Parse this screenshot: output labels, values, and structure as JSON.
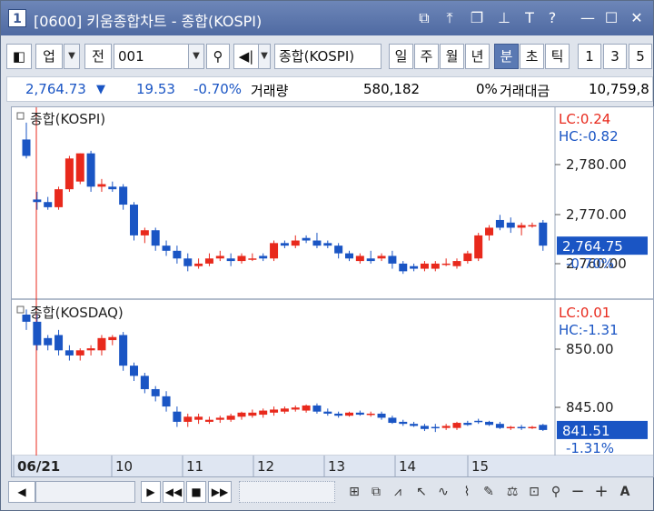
{
  "window": {
    "badge": "1",
    "title": "[0600] 키움종합차트 - 종합(KOSPI)"
  },
  "toolbar": {
    "market_label": "업",
    "all_label": "전",
    "code_value": "001",
    "name_value": "종합(KOSPI)",
    "periods": [
      "일",
      "주",
      "월",
      "년",
      "분",
      "초",
      "틱"
    ],
    "selected_period": "분",
    "intervals": [
      "1",
      "3",
      "5"
    ]
  },
  "info": {
    "price": "2,764.73",
    "change": "19.53",
    "change_pct": "-0.70%",
    "volume_label": "거래량",
    "volume": "580,182",
    "volume_pct": "0%",
    "amount_label": "거래대금",
    "amount": "10,759,8"
  },
  "colors": {
    "up": "#e8291c",
    "down": "#1a55c4",
    "price_label_bg": "#1a55c4",
    "grid": "#b9c3d2"
  },
  "x_axis": {
    "labels": [
      "06/21",
      "10",
      "11",
      "12",
      "13",
      "14",
      "15"
    ]
  },
  "chart_data": [
    {
      "type": "candlestick",
      "title": "종합(KOSPI)",
      "lc": "LC:0.24",
      "hc": "HC:-0.82",
      "y_ticks": [
        "2,780.00",
        "2,770.00",
        "2,760.00"
      ],
      "ylim": [
        2758.5,
        2789.0
      ],
      "last_price": "2,764.75",
      "last_pct": "-0.70%",
      "candles": [
        [
          2785.2,
          2788.5,
          2781.5,
          2782.0
        ],
        [
          2773.5,
          2775.0,
          2771.5,
          2773.0
        ],
        [
          2773.0,
          2774.0,
          2771.5,
          2772.0
        ],
        [
          2772.0,
          2776.0,
          2771.5,
          2775.5
        ],
        [
          2775.5,
          2782.0,
          2775.0,
          2781.5
        ],
        [
          2777.0,
          2782.5,
          2776.5,
          2782.5
        ],
        [
          2782.5,
          2783.0,
          2775.0,
          2776.0
        ],
        [
          2776.0,
          2777.5,
          2775.0,
          2776.5
        ],
        [
          2776.0,
          2777.0,
          2775.0,
          2775.5
        ],
        [
          2776.0,
          2776.5,
          2771.5,
          2772.5
        ],
        [
          2772.5,
          2773.0,
          2765.5,
          2766.5
        ],
        [
          2766.5,
          2768.0,
          2765.0,
          2767.5
        ],
        [
          2767.5,
          2768.0,
          2763.5,
          2764.5
        ],
        [
          2764.5,
          2765.5,
          2762.5,
          2763.5
        ],
        [
          2763.5,
          2764.5,
          2761.0,
          2762.0
        ],
        [
          2762.0,
          2763.0,
          2759.5,
          2760.5
        ],
        [
          2760.5,
          2762.0,
          2760.0,
          2761.0
        ],
        [
          2761.0,
          2763.0,
          2760.5,
          2762.0
        ],
        [
          2762.0,
          2763.5,
          2761.5,
          2762.5
        ],
        [
          2762.0,
          2763.0,
          2760.5,
          2761.5
        ],
        [
          2761.5,
          2763.0,
          2761.0,
          2762.5
        ],
        [
          2762.0,
          2763.0,
          2761.5,
          2762.0
        ],
        [
          2762.5,
          2763.0,
          2761.5,
          2762.0
        ],
        [
          2762.0,
          2765.5,
          2761.5,
          2765.0
        ],
        [
          2765.0,
          2765.5,
          2764.0,
          2764.5
        ],
        [
          2764.5,
          2766.5,
          2764.0,
          2765.5
        ],
        [
          2766.0,
          2766.5,
          2765.0,
          2765.5
        ],
        [
          2765.5,
          2767.0,
          2764.0,
          2764.5
        ],
        [
          2765.0,
          2765.5,
          2764.0,
          2764.5
        ],
        [
          2764.5,
          2765.0,
          2762.0,
          2763.0
        ],
        [
          2763.0,
          2763.5,
          2761.5,
          2762.0
        ],
        [
          2761.5,
          2763.0,
          2761.0,
          2762.5
        ],
        [
          2762.0,
          2763.5,
          2761.0,
          2761.5
        ],
        [
          2762.0,
          2763.0,
          2761.5,
          2762.5
        ],
        [
          2762.5,
          2763.5,
          2760.0,
          2761.0
        ],
        [
          2761.0,
          2761.5,
          2759.0,
          2759.5
        ],
        [
          2760.5,
          2761.0,
          2759.5,
          2760.0
        ],
        [
          2760.0,
          2761.5,
          2759.5,
          2761.0
        ],
        [
          2760.0,
          2761.5,
          2759.5,
          2761.0
        ],
        [
          2761.0,
          2762.0,
          2760.5,
          2761.0
        ],
        [
          2760.5,
          2762.0,
          2760.0,
          2761.5
        ],
        [
          2761.5,
          2763.5,
          2761.0,
          2763.0
        ],
        [
          2762.0,
          2767.0,
          2761.5,
          2766.5
        ],
        [
          2766.5,
          2768.5,
          2765.5,
          2768.0
        ],
        [
          2769.5,
          2770.5,
          2767.5,
          2768.0
        ],
        [
          2769.0,
          2770.0,
          2767.0,
          2768.0
        ],
        [
          2768.0,
          2769.0,
          2766.5,
          2768.5
        ],
        [
          2768.5,
          2769.0,
          2768.0,
          2768.5
        ],
        [
          2769.0,
          2769.5,
          2763.5,
          2764.5
        ]
      ]
    },
    {
      "type": "candlestick",
      "title": "종합(KOSDAQ)",
      "lc": "LC:0.01",
      "hc": "HC:-1.31",
      "y_ticks": [
        "850.00",
        "845.00"
      ],
      "ylim": [
        839.5,
        852.5
      ],
      "last_price": "841.51",
      "last_pct": "-1.31%",
      "candles": [
        [
          852.5,
          853.0,
          851.0,
          851.8
        ],
        [
          851.8,
          852.5,
          849.0,
          849.5
        ],
        [
          850.2,
          850.5,
          849.0,
          849.5
        ],
        [
          850.5,
          851.0,
          848.5,
          849.0
        ],
        [
          849.0,
          849.5,
          848.0,
          848.5
        ],
        [
          848.5,
          849.2,
          848.0,
          849.0
        ],
        [
          849.0,
          849.5,
          848.5,
          849.2
        ],
        [
          849.0,
          850.5,
          848.5,
          850.2
        ],
        [
          850.0,
          850.5,
          849.5,
          850.3
        ],
        [
          850.5,
          850.8,
          847.0,
          847.5
        ],
        [
          847.5,
          847.8,
          846.0,
          846.5
        ],
        [
          846.5,
          846.8,
          844.8,
          845.2
        ],
        [
          845.2,
          845.5,
          844.0,
          844.5
        ],
        [
          844.5,
          845.0,
          843.0,
          843.5
        ],
        [
          843.0,
          843.5,
          841.5,
          842.0
        ],
        [
          842.0,
          842.8,
          841.5,
          842.5
        ],
        [
          842.2,
          842.8,
          841.8,
          842.5
        ],
        [
          842.0,
          842.5,
          841.8,
          842.2
        ],
        [
          842.2,
          842.6,
          841.9,
          842.4
        ],
        [
          842.2,
          842.8,
          842.0,
          842.6
        ],
        [
          842.5,
          843.0,
          842.2,
          842.9
        ],
        [
          842.6,
          843.2,
          842.4,
          842.9
        ],
        [
          842.7,
          843.3,
          842.4,
          843.1
        ],
        [
          842.9,
          843.5,
          842.6,
          843.2
        ],
        [
          843.0,
          843.5,
          842.8,
          843.3
        ],
        [
          843.2,
          843.6,
          843.0,
          843.4
        ],
        [
          843.1,
          843.7,
          842.9,
          843.6
        ],
        [
          843.6,
          843.8,
          842.8,
          843.0
        ],
        [
          843.0,
          843.3,
          842.6,
          842.8
        ],
        [
          842.8,
          843.0,
          842.4,
          842.6
        ],
        [
          842.6,
          843.0,
          842.5,
          842.9
        ],
        [
          842.9,
          843.1,
          842.6,
          842.7
        ],
        [
          842.7,
          843.0,
          842.5,
          842.8
        ],
        [
          842.8,
          843.0,
          842.2,
          842.4
        ],
        [
          842.4,
          842.6,
          841.8,
          841.9
        ],
        [
          842.0,
          842.2,
          841.6,
          841.8
        ],
        [
          841.8,
          842.0,
          841.5,
          841.6
        ],
        [
          841.6,
          841.8,
          841.1,
          841.3
        ],
        [
          841.5,
          841.8,
          841.0,
          841.4
        ],
        [
          841.4,
          841.8,
          841.2,
          841.6
        ],
        [
          841.4,
          842.0,
          841.2,
          841.9
        ],
        [
          841.9,
          842.1,
          841.6,
          841.7
        ],
        [
          842.1,
          842.3,
          841.8,
          842.0
        ],
        [
          842.0,
          842.1,
          841.6,
          841.7
        ],
        [
          841.8,
          842.0,
          841.3,
          841.4
        ],
        [
          841.4,
          841.6,
          841.2,
          841.5
        ],
        [
          841.5,
          841.7,
          841.2,
          841.4
        ],
        [
          841.5,
          841.6,
          841.3,
          841.5
        ],
        [
          841.7,
          841.8,
          841.1,
          841.2
        ]
      ]
    }
  ],
  "bottom": {
    "scroll_left": "◀",
    "play_labels": [
      "▶",
      "◀◀",
      "■",
      "▶▶"
    ],
    "zoom_out": "−",
    "zoom_in": "+",
    "auto": "A"
  }
}
